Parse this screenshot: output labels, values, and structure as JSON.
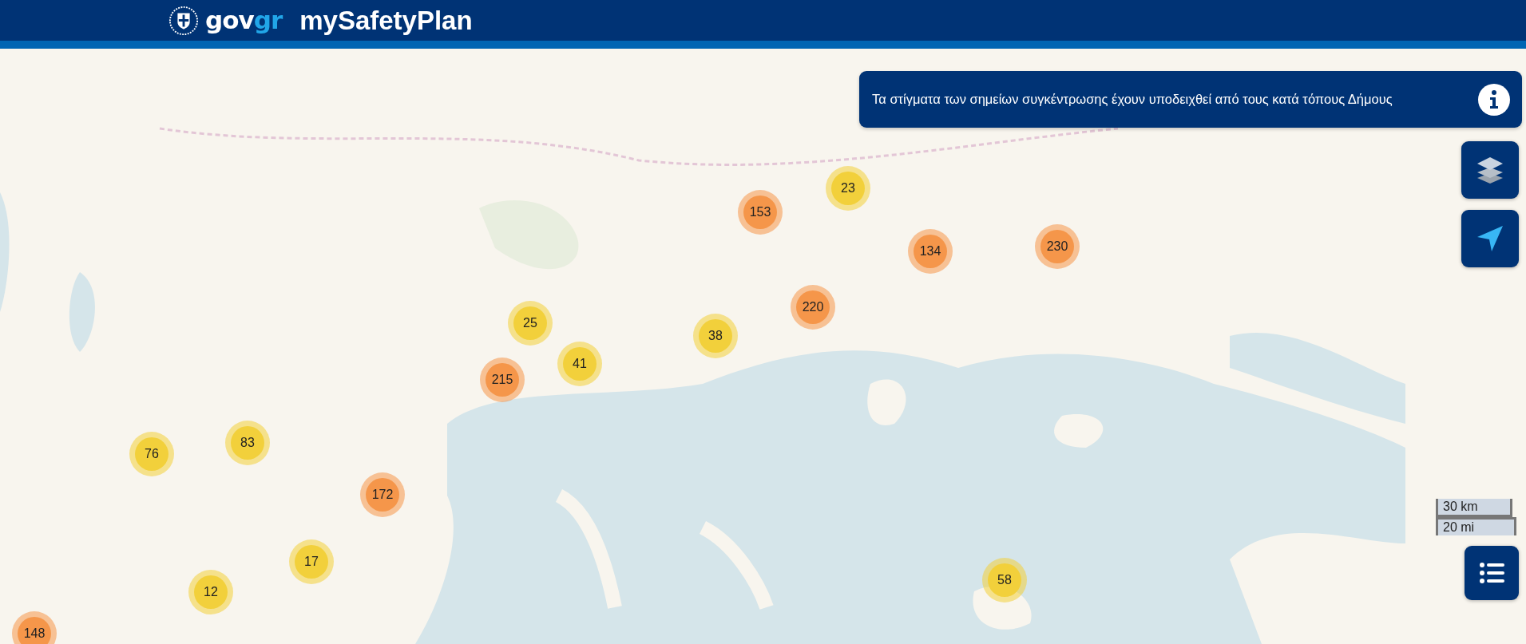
{
  "header": {
    "logo_prefix": "gov",
    "logo_suffix": "gr",
    "title": "mySafetyPlan"
  },
  "notice": {
    "text": "Τα στίγματα των σημείων συγκέντρωσης έχουν υποδειχθεί από τους κατά τόπους Δήμους"
  },
  "markers": [
    {
      "count": "23",
      "color": "#f2d03b"
    },
    {
      "count": "153",
      "color": "#f5964a"
    },
    {
      "count": "134",
      "color": "#f5964a"
    },
    {
      "count": "230",
      "color": "#f5964a"
    },
    {
      "count": "220",
      "color": "#f5964a"
    },
    {
      "count": "38",
      "color": "#f2d03b"
    },
    {
      "count": "25",
      "color": "#f2d03b"
    },
    {
      "count": "41",
      "color": "#f2d03b"
    },
    {
      "count": "215",
      "color": "#f5964a"
    },
    {
      "count": "76",
      "color": "#f2d03b"
    },
    {
      "count": "83",
      "color": "#f2d03b"
    },
    {
      "count": "172",
      "color": "#f5964a"
    },
    {
      "count": "17",
      "color": "#f2d03b"
    },
    {
      "count": "12",
      "color": "#f2d03b"
    },
    {
      "count": "148",
      "color": "#f5964a"
    },
    {
      "count": "58",
      "color": "#f2d03b"
    }
  ],
  "scale": {
    "metric": "30 km",
    "imperial": "20 mi"
  }
}
